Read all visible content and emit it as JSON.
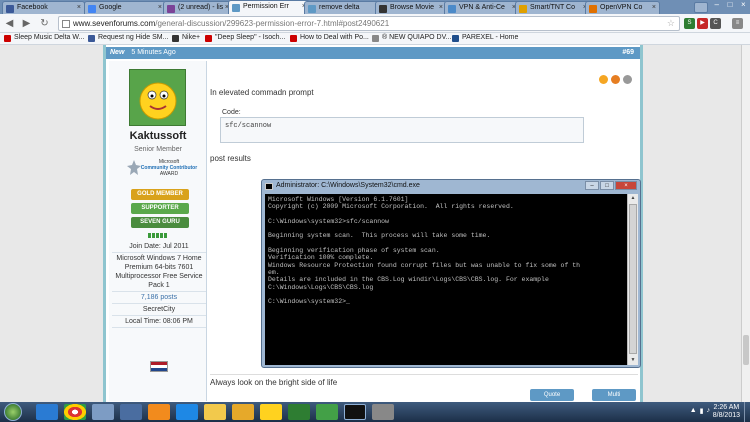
{
  "browser": {
    "tabs": [
      {
        "label": "Facebook",
        "icon_color": "#3b5998"
      },
      {
        "label": "Google",
        "icon_color": "#4285f4"
      },
      {
        "label": "(2 unread) - lis",
        "icon_color": "#7b4397"
      },
      {
        "label": "Permission Err",
        "icon_color": "#5e99c5"
      },
      {
        "label": "remove delta",
        "icon_color": "#5e99c5"
      },
      {
        "label": "Browse Movie",
        "icon_color": "#333333"
      },
      {
        "label": "VPN & Anti-Ce",
        "icon_color": "#4b8ac9"
      },
      {
        "label": "Smart/TNT Co",
        "icon_color": "#e0a000"
      },
      {
        "label": "OpenVPN Co",
        "icon_color": "#e07000"
      }
    ],
    "url_host": "www.sevenforums.com",
    "url_path": "/general-discussion/299623-permission-error-7.html#post2490621",
    "bookmarks": [
      {
        "label": "Sleep Music Delta W...",
        "icon_color": "#cc0000"
      },
      {
        "label": "Request ng Hide SM...",
        "icon_color": "#3b5998"
      },
      {
        "label": "Nike+",
        "icon_color": "#333333"
      },
      {
        "label": "\"Deep Sleep\" - Isoch...",
        "icon_color": "#cc0000"
      },
      {
        "label": "How to Deal with Po...",
        "icon_color": "#cc0000"
      },
      {
        "label": "® NEW QUIAPO DV...",
        "icon_color": "#888888"
      },
      {
        "label": "PAREXEL - Home",
        "icon_color": "#1f4e8c"
      }
    ]
  },
  "post": {
    "new_label": "New",
    "time": "5 Minutes Ago",
    "number": "#69",
    "username": "Kaktussoft",
    "user_title": "Senior Member",
    "award": [
      "Microsoft",
      "Community Contributor",
      "AWARD"
    ],
    "badges": {
      "gold": "GOLD MEMBER",
      "supporter": "SUPPORTER",
      "guru": "SEVEN GURU"
    },
    "profile": {
      "join": "Join Date: Jul 2011",
      "os": "Microsoft Windows 7 Home Premium 64-bits 7601 Multiprocessor Free Service Pack 1",
      "posts": "7,186 posts",
      "location": "SecretCity",
      "local_time": "Local Time: 08:06 PM"
    },
    "text1": "In elevated commadn prompt",
    "code_label": "Code:",
    "code": "sfc/scannow",
    "text2": "post results",
    "signature": "Always look on the bright side of life",
    "quote_btn": "Quote",
    "multi_btn": "Multi"
  },
  "cmd": {
    "title": "Administrator: C:\\Windows\\System32\\cmd.exe",
    "console": "Microsoft Windows [Version 6.1.7601]\nCopyright (c) 2009 Microsoft Corporation.  All rights reserved.\n\nC:\\Windows\\system32>sfc/scannow\n\nBeginning system scan.  This process will take some time.\n\nBeginning verification phase of system scan.\nVerification 100% complete.\nWindows Resource Protection found corrupt files but was unable to fix some of th\nem.\nDetails are included in the CBS.Log windir\\Logs\\CBS\\CBS.log. For example\nC:\\Windows\\Logs\\CBS\\CBS.log\n\nC:\\Windows\\system32>_"
  },
  "taskbar": {
    "time": "2:26 AM",
    "date": "8/8/2013"
  }
}
